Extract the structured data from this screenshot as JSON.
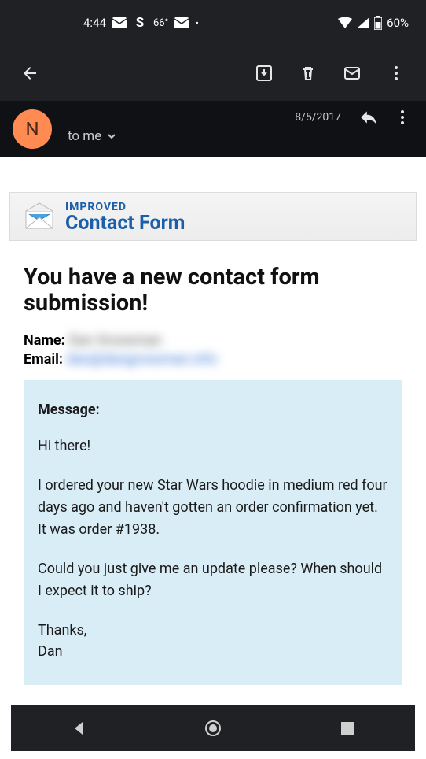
{
  "status": {
    "time": "4:44",
    "temp": "66°",
    "battery": "60%"
  },
  "email_header": {
    "avatar_letter": "N",
    "recipient": "to me",
    "date": "8/5/2017"
  },
  "banner": {
    "small": "IMPROVED",
    "big": "Contact Form"
  },
  "body": {
    "heading": "You have a new contact form submission!",
    "name_label": "Name:",
    "name_value": "Dan Grossman",
    "email_label": "Email:",
    "email_value": "dan@dangrossman.info",
    "message_label": "Message:",
    "p1": "Hi there!",
    "p2": "I ordered your new Star Wars hoodie in medium red four days ago and haven't gotten an order confirmation yet. It was order #1938.",
    "p3": "Could you just give me an update please? When should I expect it to ship?",
    "p4a": "Thanks,",
    "p4b": "Dan"
  }
}
